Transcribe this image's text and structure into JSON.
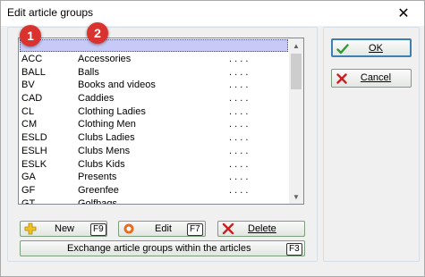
{
  "window": {
    "title": "Edit article groups",
    "close_symbol": "✕"
  },
  "badges": [
    "1",
    "2"
  ],
  "list": {
    "rows": [
      {
        "code": "ACC",
        "name": "Accessories",
        "dots": ". . . ."
      },
      {
        "code": "BALL",
        "name": "Balls",
        "dots": ". . . ."
      },
      {
        "code": "BV",
        "name": "Books and videos",
        "dots": ". . . ."
      },
      {
        "code": "CAD",
        "name": "Caddies",
        "dots": ". . . ."
      },
      {
        "code": "CL",
        "name": "Clothing Ladies",
        "dots": ". . . ."
      },
      {
        "code": "CM",
        "name": "Clothing Men",
        "dots": ". . . ."
      },
      {
        "code": "ESLD",
        "name": "Clubs Ladies",
        "dots": ". . . ."
      },
      {
        "code": "ESLH",
        "name": "Clubs Mens",
        "dots": ". . . ."
      },
      {
        "code": "ESLK",
        "name": "Clubs Kids",
        "dots": ". . . ."
      },
      {
        "code": "GA",
        "name": "Presents",
        "dots": ". . . ."
      },
      {
        "code": "GF",
        "name": "Greenfee",
        "dots": ". . . ."
      },
      {
        "code": "GT",
        "name": "Golfbags",
        "dots": ". . . ."
      }
    ]
  },
  "buttons": {
    "new_label": "New",
    "new_key": "F9",
    "edit_label": "Edit",
    "edit_key": "F7",
    "delete_label": "Delete",
    "exchange_label": "Exchange article groups within the articles",
    "exchange_key": "F3",
    "ok_label": "OK",
    "cancel_label": "Cancel"
  },
  "colors": {
    "badge": "#d9322f",
    "selection": "#c7c9f7",
    "ok_check": "#2e9c2e",
    "cancel_x": "#cc1f1f",
    "new_plus": "#f0c020",
    "edit_ring": "#e86a1a"
  }
}
